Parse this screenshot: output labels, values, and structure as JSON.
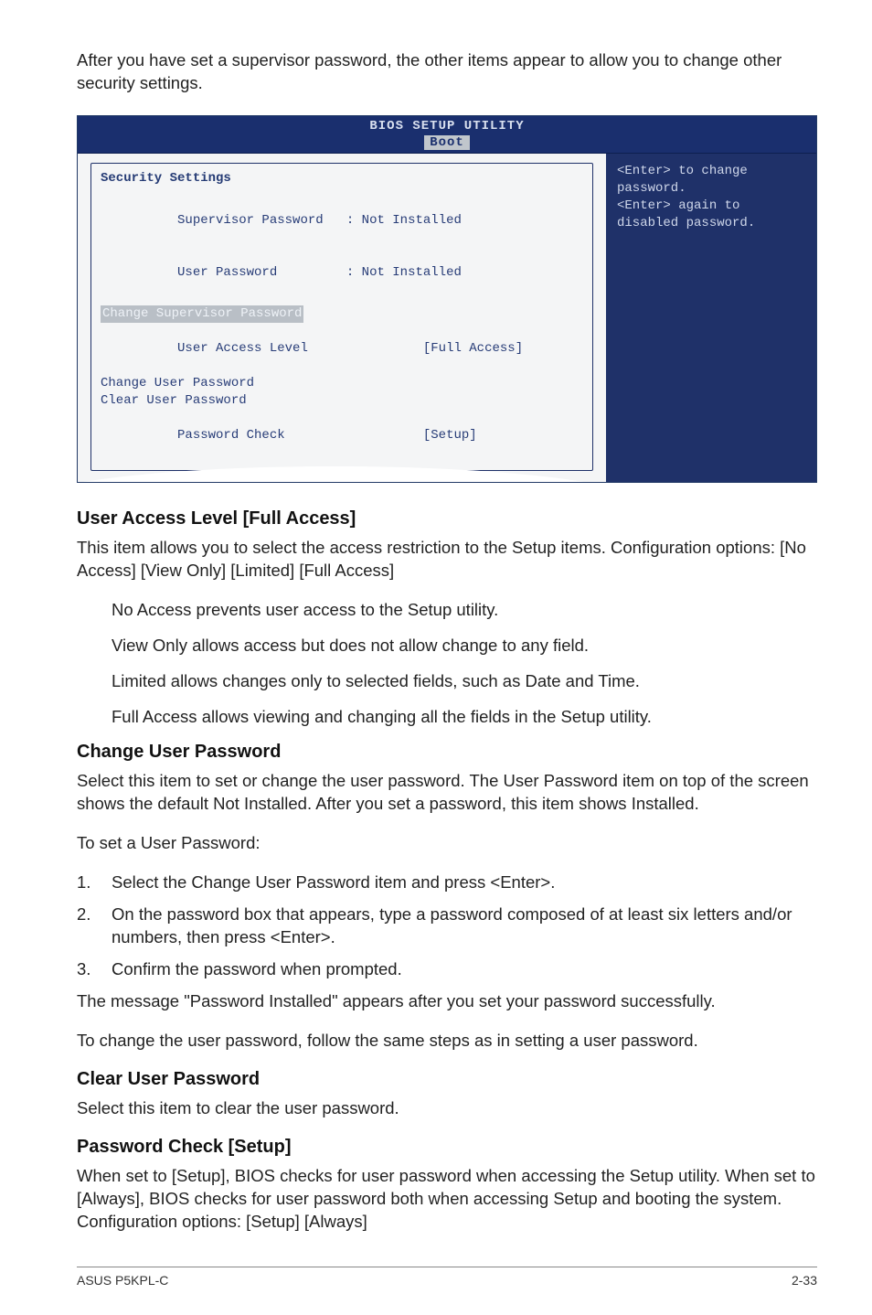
{
  "intro_text": "After you have set a supervisor password, the other items appear to allow you to change other security settings.",
  "bios": {
    "title_top": "BIOS SETUP UTILITY",
    "title_tab": "Boot",
    "heading": "Security Settings",
    "supervisor_label": "Supervisor Password",
    "supervisor_value": ": Not Installed",
    "user_label": "User Password",
    "user_value": ": Not Installed",
    "change_supervisor": "Change Supervisor Password",
    "user_access_label": "User Access Level",
    "user_access_value": "[Full Access]",
    "change_user": "Change User Password",
    "clear_user": "Clear User Password",
    "pw_check_label": "Password Check",
    "pw_check_value": "[Setup]",
    "help1": "<Enter> to change password.",
    "help2": "<Enter> again to disabled password."
  },
  "user_access": {
    "heading": "User Access Level [Full Access]",
    "p1": "This item allows you to select the access restriction to the Setup items. Configuration options: [No Access] [View Only] [Limited] [Full Access]",
    "no_access": "No Access prevents user access to the Setup utility.",
    "view_only": "View Only allows access but does not allow change to any field.",
    "limited": "Limited allows changes only to selected fields, such as Date and Time.",
    "full_access": "Full Access allows viewing and changing all the fields in the Setup utility."
  },
  "change_user_pw": {
    "heading": "Change User Password",
    "p1": "Select this item to set or change the user password. The User Password item on top of the screen shows the default Not Installed. After you set a password, this item shows Installed.",
    "p2": "To set a User Password:",
    "step1": "Select the Change User Password item and press <Enter>.",
    "step2": "On the password box that appears, type a password composed of at least six letters and/or numbers, then press <Enter>.",
    "step3": "Confirm the password when prompted.",
    "p3": "The message \"Password Installed\" appears after you set your password successfully.",
    "p4": "To change the user password, follow the same steps as in setting a user password."
  },
  "clear_user_pw": {
    "heading": "Clear User Password",
    "p1": "Select this item to clear the user password."
  },
  "pw_check": {
    "heading": "Password Check [Setup]",
    "p1": "When set to [Setup], BIOS checks for user password when accessing the Setup utility. When set to [Always], BIOS checks for user password both when accessing Setup and booting the system. Configuration options: [Setup] [Always]"
  },
  "footer": {
    "left": "ASUS P5KPL-C",
    "right": "2-33"
  }
}
